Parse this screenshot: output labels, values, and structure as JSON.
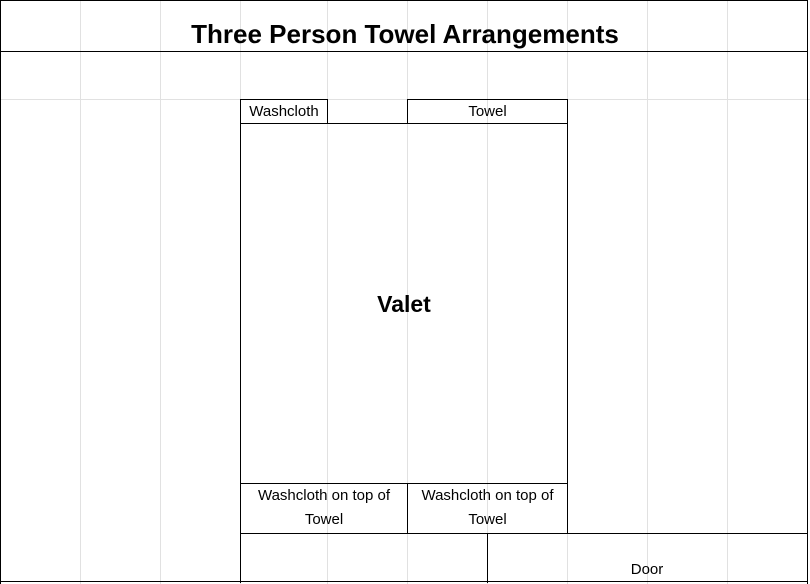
{
  "title": "Three Person Towel Arrangements",
  "valet_label": "Valet",
  "top_left_label": "Washcloth",
  "top_right_label": "Towel",
  "bottom_left_label": [
    "Washcloth on top of",
    "Towel"
  ],
  "bottom_right_label": [
    "Washcloth on top of",
    "Towel"
  ],
  "door_label": "Door",
  "colors": {
    "gridline": "#e1e1e1",
    "border": "#000000",
    "background": "#ffffff"
  }
}
